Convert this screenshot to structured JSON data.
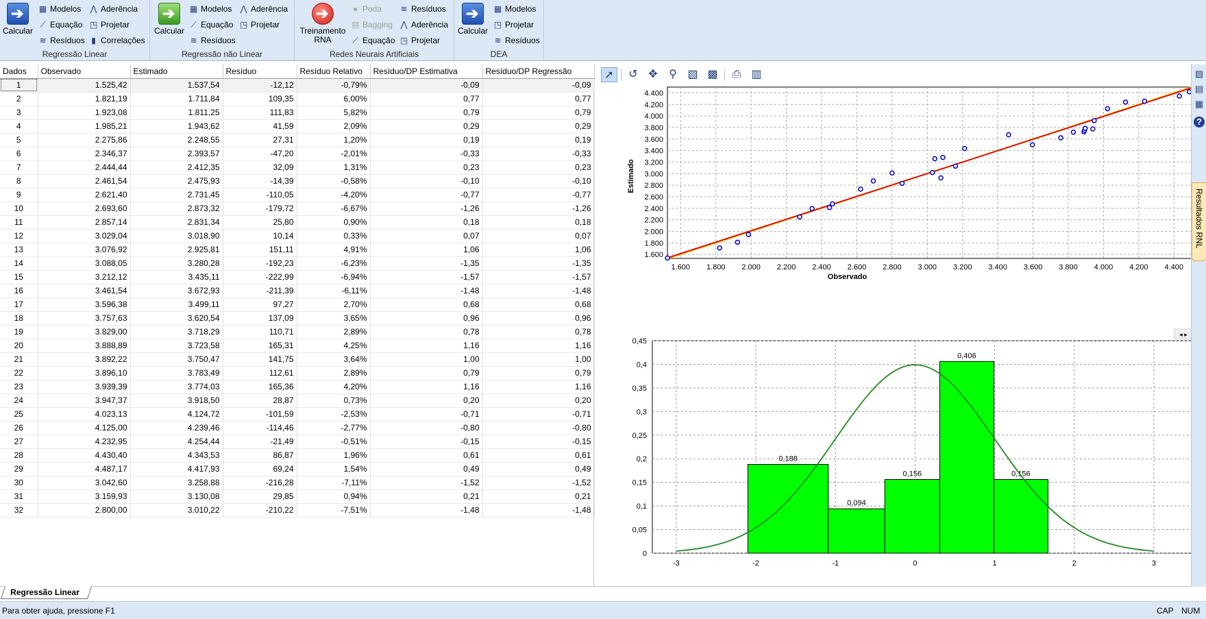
{
  "ribbon": {
    "groups": [
      {
        "caption": "Regressão Linear",
        "big_button": {
          "label": "Calcular",
          "icon": "blue-arrow-icon"
        },
        "col1": [
          {
            "label": "Modelos",
            "icon": "models-icon"
          },
          {
            "label": "Equação",
            "icon": "equation-icon"
          },
          {
            "label": "Resíduos",
            "icon": "residuals-icon"
          }
        ],
        "col2": [
          {
            "label": "Aderência",
            "icon": "adherence-icon"
          },
          {
            "label": "Projetar",
            "icon": "project-icon"
          },
          {
            "label": "Correlações",
            "icon": "correlations-icon"
          }
        ]
      },
      {
        "caption": "Regressão não Linear",
        "big_button": {
          "label": "Calcular",
          "icon": "green-arrow-icon"
        },
        "col1": [
          {
            "label": "Modelos",
            "icon": "models-icon"
          },
          {
            "label": "Equação",
            "icon": "equation-icon"
          },
          {
            "label": "Resíduos",
            "icon": "residuals-icon"
          }
        ],
        "col2": [
          {
            "label": "Aderência",
            "icon": "adherence-icon"
          },
          {
            "label": "Projetar",
            "icon": "project-icon"
          }
        ]
      },
      {
        "caption": "Redes Neurais Artificiais",
        "big_button": {
          "label_line1": "Treinamento",
          "label_line2": "RNA",
          "icon": "red-arrow-icon"
        },
        "col1": [
          {
            "label": "Poda",
            "icon": "prune-icon",
            "disabled": true
          },
          {
            "label": "Bagging",
            "icon": "bagging-icon",
            "disabled": true
          },
          {
            "label": "Equação",
            "icon": "equation-icon"
          }
        ],
        "col2": [
          {
            "label": "Resíduos",
            "icon": "residuals-icon"
          },
          {
            "label": "Aderência",
            "icon": "adherence-icon"
          },
          {
            "label": "Projetar",
            "icon": "project-icon"
          }
        ]
      },
      {
        "caption": "DEA",
        "big_button": {
          "label": "Calcular",
          "icon": "dark-blue-arrow-icon"
        },
        "col1": [
          {
            "label": "Modelos",
            "icon": "models-icon"
          },
          {
            "label": "Projetar",
            "icon": "project-icon"
          },
          {
            "label": "Resíduos",
            "icon": "residuals-icon"
          }
        ]
      }
    ]
  },
  "table": {
    "headers": [
      "Dados",
      "Observado",
      "Estimado",
      "Resíduo",
      "Resíduo Relativo",
      "Resíduo/DP Estimativa",
      "Resíduo/DP Regressão"
    ],
    "rows": [
      [
        "1",
        "1.525,42",
        "1.537,54",
        "-12,12",
        "-0,79%",
        "-0,09",
        "-0,09"
      ],
      [
        "2",
        "1.821,19",
        "1.711,84",
        "109,35",
        "6,00%",
        "0,77",
        "0,77"
      ],
      [
        "3",
        "1.923,08",
        "1.811,25",
        "111,83",
        "5,82%",
        "0,79",
        "0,79"
      ],
      [
        "4",
        "1.985,21",
        "1.943,62",
        "41,59",
        "2,09%",
        "0,29",
        "0,29"
      ],
      [
        "5",
        "2.275,86",
        "2.248,55",
        "27,31",
        "1,20%",
        "0,19",
        "0,19"
      ],
      [
        "6",
        "2.346,37",
        "2.393,57",
        "-47,20",
        "-2,01%",
        "-0,33",
        "-0,33"
      ],
      [
        "7",
        "2.444,44",
        "2.412,35",
        "32,09",
        "1,31%",
        "0,23",
        "0,23"
      ],
      [
        "8",
        "2.461,54",
        "2.475,93",
        "-14,39",
        "-0,58%",
        "-0,10",
        "-0,10"
      ],
      [
        "9",
        "2.621,40",
        "2.731,45",
        "-110,05",
        "-4,20%",
        "-0,77",
        "-0,77"
      ],
      [
        "10",
        "2.693,60",
        "2.873,32",
        "-179,72",
        "-6,67%",
        "-1,26",
        "-1,26"
      ],
      [
        "11",
        "2.857,14",
        "2.831,34",
        "25,80",
        "0,90%",
        "0,18",
        "0,18"
      ],
      [
        "12",
        "3.029,04",
        "3.018,90",
        "10,14",
        "0,33%",
        "0,07",
        "0,07"
      ],
      [
        "13",
        "3.076,92",
        "2.925,81",
        "151,11",
        "4,91%",
        "1,06",
        "1,06"
      ],
      [
        "14",
        "3.088,05",
        "3.280,28",
        "-192,23",
        "-6,23%",
        "-1,35",
        "-1,35"
      ],
      [
        "15",
        "3.212,12",
        "3.435,11",
        "-222,99",
        "-6,94%",
        "-1,57",
        "-1,57"
      ],
      [
        "16",
        "3.461,54",
        "3.672,93",
        "-211,39",
        "-6,11%",
        "-1,48",
        "-1,48"
      ],
      [
        "17",
        "3.596,38",
        "3.499,11",
        "97,27",
        "2,70%",
        "0,68",
        "0,68"
      ],
      [
        "18",
        "3.757,63",
        "3.620,54",
        "137,09",
        "3,65%",
        "0,96",
        "0,96"
      ],
      [
        "19",
        "3.829,00",
        "3.718,29",
        "110,71",
        "2,89%",
        "0,78",
        "0,78"
      ],
      [
        "20",
        "3.888,89",
        "3.723,58",
        "165,31",
        "4,25%",
        "1,16",
        "1,16"
      ],
      [
        "21",
        "3.892,22",
        "3.750,47",
        "141,75",
        "3,64%",
        "1,00",
        "1,00"
      ],
      [
        "22",
        "3.896,10",
        "3.783,49",
        "112,61",
        "2,89%",
        "0,79",
        "0,79"
      ],
      [
        "23",
        "3.939,39",
        "3.774,03",
        "165,36",
        "4,20%",
        "1,16",
        "1,16"
      ],
      [
        "24",
        "3.947,37",
        "3.918,50",
        "28,87",
        "0,73%",
        "0,20",
        "0,20"
      ],
      [
        "25",
        "4.023,13",
        "4.124,72",
        "-101,59",
        "-2,53%",
        "-0,71",
        "-0,71"
      ],
      [
        "26",
        "4.125,00",
        "4.239,46",
        "-114,46",
        "-2,77%",
        "-0,80",
        "-0,80"
      ],
      [
        "27",
        "4.232,95",
        "4.254,44",
        "-21,49",
        "-0,51%",
        "-0,15",
        "-0,15"
      ],
      [
        "28",
        "4.430,40",
        "4.343,53",
        "86,87",
        "1,96%",
        "0,61",
        "0,61"
      ],
      [
        "29",
        "4.487,17",
        "4.417,93",
        "69,24",
        "1,54%",
        "0,49",
        "0,49"
      ],
      [
        "30",
        "3.042,60",
        "3.258,88",
        "-216,28",
        "-7,11%",
        "-1,52",
        "-1,52"
      ],
      [
        "31",
        "3.159,93",
        "3.130,08",
        "29,85",
        "0,94%",
        "0,21",
        "0,21"
      ],
      [
        "32",
        "2.800,00",
        "3.010,22",
        "-210,22",
        "-7,51%",
        "-1,48",
        "-1,48"
      ]
    ]
  },
  "chart_toolbar": {
    "buttons": [
      "pointer-icon",
      "undo-icon",
      "pan-icon",
      "zoom-icon",
      "export-image-icon",
      "export-data-icon",
      "print-icon",
      "copy-icon"
    ]
  },
  "chart_data": [
    {
      "type": "scatter",
      "xlabel": "Observado",
      "ylabel": "Estimado",
      "xlim": [
        1525,
        4500
      ],
      "ylim": [
        1530,
        4500
      ],
      "xticks": [
        "1.600",
        "1.800",
        "2.000",
        "2.200",
        "2.400",
        "2.600",
        "2.800",
        "3.000",
        "3.200",
        "3.400",
        "3.600",
        "3.800",
        "4.000",
        "4.200",
        "4.400"
      ],
      "yticks": [
        "1.600",
        "1.800",
        "2.000",
        "2.200",
        "2.400",
        "2.600",
        "2.800",
        "3.000",
        "3.200",
        "3.400",
        "3.600",
        "3.800",
        "4.000",
        "4.200",
        "4.400"
      ],
      "grid": true,
      "series": [
        {
          "kind": "points",
          "color": "#0000cc",
          "x": [
            1525.42,
            1821.19,
            1923.08,
            1985.21,
            2275.86,
            2346.37,
            2444.44,
            2461.54,
            2621.4,
            2693.6,
            2857.14,
            3029.04,
            3076.92,
            3088.05,
            3212.12,
            3461.54,
            3596.38,
            3757.63,
            3829.0,
            3888.89,
            3892.22,
            3896.1,
            3939.39,
            3947.37,
            4023.13,
            4125.0,
            4232.95,
            4430.4,
            4487.17,
            3042.6,
            3159.93,
            2800.0
          ],
          "y": [
            1537.54,
            1711.84,
            1811.25,
            1943.62,
            2248.55,
            2393.57,
            2412.35,
            2475.93,
            2731.45,
            2873.32,
            2831.34,
            3018.9,
            2925.81,
            3280.28,
            3435.11,
            3672.93,
            3499.11,
            3620.54,
            3718.29,
            3723.58,
            3750.47,
            3783.49,
            3774.03,
            3918.5,
            4124.72,
            4239.46,
            4254.44,
            4343.53,
            4417.93,
            3258.88,
            3130.08,
            3010.22
          ]
        },
        {
          "kind": "line",
          "color": "#ffcc00",
          "x": [
            1525,
            4500
          ],
          "y": [
            1525,
            4500
          ]
        },
        {
          "kind": "line",
          "color": "#dd1100",
          "x": [
            1525,
            4500
          ],
          "y": [
            1540,
            4487
          ]
        }
      ]
    },
    {
      "type": "bar",
      "xlim": [
        -3.3,
        3.5
      ],
      "ylim": [
        0,
        0.45
      ],
      "xticks": [
        "-3",
        "-2",
        "-1",
        "0",
        "1",
        "2",
        "3"
      ],
      "yticks": [
        "0",
        "0,05",
        "0,1",
        "0,15",
        "0,2",
        "0,25",
        "0,3",
        "0,35",
        "0,4",
        "0,45"
      ],
      "grid": true,
      "bars": [
        {
          "from": -2.1,
          "to": -1.09,
          "value": 0.188,
          "label": "0,188"
        },
        {
          "from": -1.09,
          "to": -0.38,
          "value": 0.094,
          "label": "0,094"
        },
        {
          "from": -0.38,
          "to": 0.31,
          "value": 0.156,
          "label": "0,156"
        },
        {
          "from": 0.31,
          "to": 0.99,
          "value": 0.406,
          "label": "0,406"
        },
        {
          "from": 0.99,
          "to": 1.67,
          "value": 0.156,
          "label": "0,156"
        }
      ],
      "bar_color": "#00ff00",
      "curve": {
        "kind": "normal-density",
        "mean": 0,
        "sd": 1,
        "from": -3,
        "to": 3,
        "color": "#1f8a1f"
      }
    }
  ],
  "dock": {
    "tab_label": "Resultados RNL",
    "icons": [
      "chart-icon",
      "table-icon",
      "report-icon",
      "help-icon"
    ]
  },
  "sheet_tab": "Regressão Linear",
  "status": {
    "help_text": "Para obter ajuda, pressione F1",
    "cap": "CAP",
    "num": "NUM"
  }
}
